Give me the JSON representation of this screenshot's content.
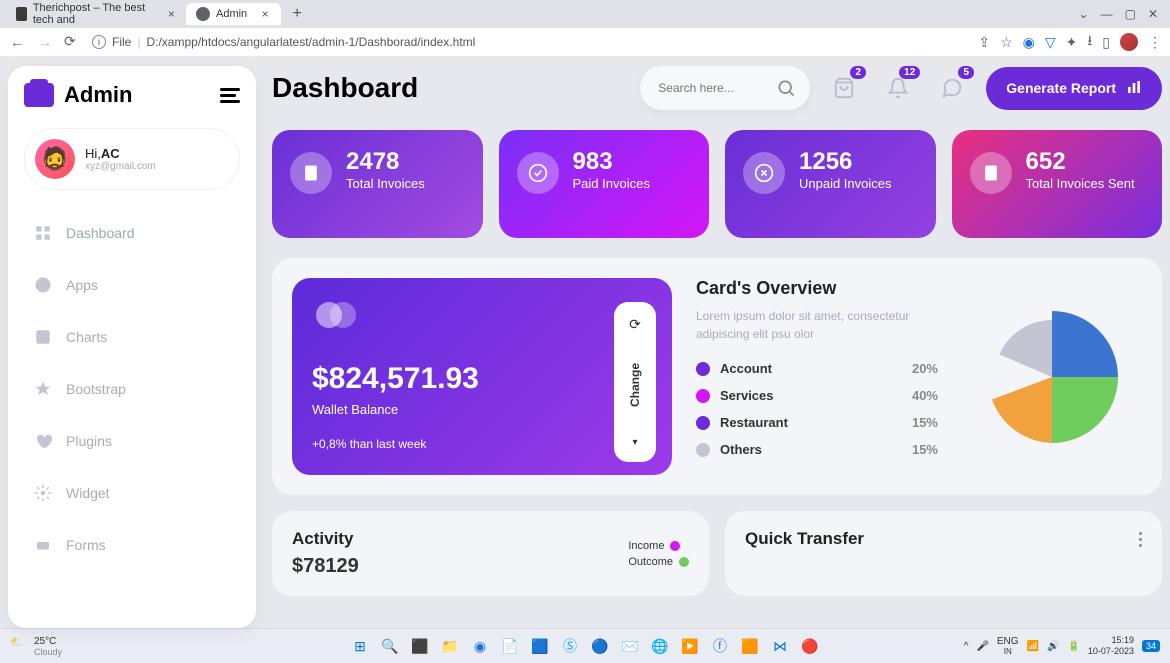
{
  "browser": {
    "tabs": [
      {
        "title": "Therichpost – The best tech and"
      },
      {
        "title": "Admin"
      }
    ],
    "url_prefix": "File",
    "url": "D:/xampp/htdocs/angularlatest/admin-1/Dashborad/index.html"
  },
  "sidebar": {
    "logo": "Admin",
    "user_greeting": "Hi,",
    "user_name": "AC",
    "user_email": "xyz@gmail.com",
    "items": [
      {
        "label": "Dashboard"
      },
      {
        "label": "Apps"
      },
      {
        "label": "Charts"
      },
      {
        "label": "Bootstrap"
      },
      {
        "label": "Plugins"
      },
      {
        "label": "Widget"
      },
      {
        "label": "Forms"
      }
    ]
  },
  "header": {
    "title": "Dashboard",
    "search_placeholder": "Search here...",
    "badges": {
      "bag": "2",
      "bell": "12",
      "chat": "5"
    },
    "report_btn": "Generate Report"
  },
  "stats": [
    {
      "value": "2478",
      "label": "Total Invoices"
    },
    {
      "value": "983",
      "label": "Paid Invoices"
    },
    {
      "value": "1256",
      "label": "Unpaid Invoices"
    },
    {
      "value": "652",
      "label": "Total Invoices Sent"
    }
  ],
  "wallet": {
    "amount": "$824,571.93",
    "label": "Wallet Balance",
    "delta": "+0,8% than last week",
    "change_btn": "Change"
  },
  "overview": {
    "title": "Card's Overview",
    "desc": "Lorem ipsum dolor sit amet, consectetur adipiscing elit psu olor",
    "rows": [
      {
        "name": "Account",
        "pct": "20%",
        "color": "#6c2bd9"
      },
      {
        "name": "Services",
        "pct": "40%",
        "color": "#d415f7"
      },
      {
        "name": "Restaurant",
        "pct": "15%",
        "color": "#6c2bd9"
      },
      {
        "name": "Others",
        "pct": "15%",
        "color": "#c3c6d2"
      }
    ]
  },
  "chart_data": {
    "type": "pie",
    "title": "Card's Overview",
    "series": [
      {
        "name": "Account",
        "value": 20,
        "color": "#3b74d1"
      },
      {
        "name": "Services",
        "value": 40,
        "color": "#6fcd5d"
      },
      {
        "name": "Restaurant",
        "value": 15,
        "color": "#f2a23c"
      },
      {
        "name": "Others",
        "value": 15,
        "color": "#c3c6d2"
      }
    ]
  },
  "activity": {
    "title": "Activity",
    "amount": "$78129",
    "legend": [
      {
        "label": "Income",
        "color": "#d415f7"
      },
      {
        "label": "Outcome",
        "color": "#6fcd5d"
      }
    ]
  },
  "transfer": {
    "title": "Quick Transfer"
  },
  "taskbar": {
    "temp": "25°C",
    "weather": "Cloudy",
    "lang": "ENG",
    "region": "IN",
    "time": "15:19",
    "date": "10-07-2023",
    "notif": "34"
  }
}
